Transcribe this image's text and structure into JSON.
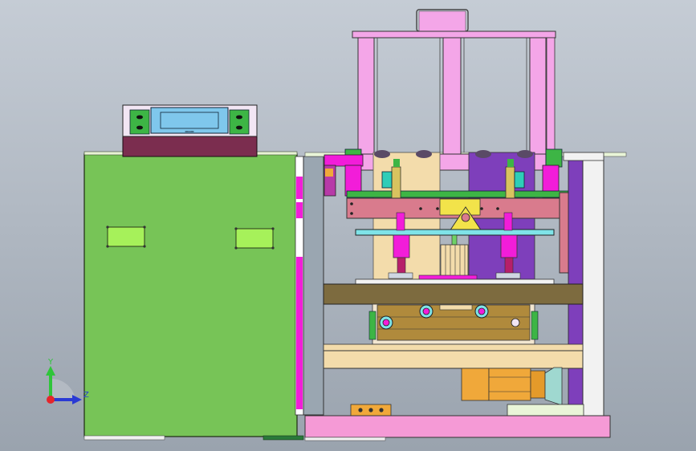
{
  "viewport": {
    "background_top": "#c5ccd5",
    "background_bottom": "#9aa3ae"
  },
  "colors": {
    "cabinet_green": "#77c457",
    "panel_green": "#a6f15a",
    "top_box": "#7b2d4f",
    "display_blue": "#7fc7ec",
    "pink": "#f4a6e8",
    "magenta": "#f21dd9",
    "tan": "#f3dcab",
    "purple": "#7e3fbb",
    "olive": "#7d6b3f",
    "rose": "#d97b8d",
    "cyan": "#7fe3e8",
    "motor": "#f0a83a",
    "base_pink": "#f59ad6",
    "gray_post": "#9aa6b1"
  },
  "triad": {
    "y_label": "Y",
    "z_label": "Z",
    "y_color": "#2fc53a",
    "z_color": "#2a3ad4",
    "origin_color": "#e5252b"
  },
  "display": {
    "text": "━╍━"
  }
}
